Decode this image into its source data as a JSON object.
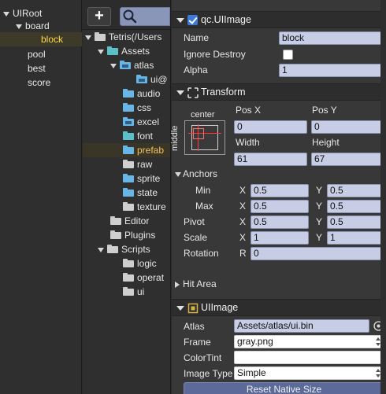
{
  "hierarchy": {
    "root": "UIRoot",
    "board": "board",
    "block": "block",
    "pool": "pool",
    "best": "best",
    "score": "score"
  },
  "project": {
    "add_label": "+",
    "root": "Tetris(/Users",
    "assets": "Assets",
    "atlas": "atlas",
    "ui": "ui@",
    "audio": "audio",
    "css": "css",
    "excel": "excel",
    "font": "font",
    "prefab": "prefab",
    "raw": "raw",
    "sprite": "sprite",
    "state": "state",
    "texture": "texture",
    "editor": "Editor",
    "plugins": "Plugins",
    "scripts": "Scripts",
    "logic": "logic",
    "operat": "operat",
    "ui_scripts": "ui"
  },
  "inspector": {
    "component_title": "qc.UIImage",
    "name_label": "Name",
    "name_value": "block",
    "ignore_destroy_label": "Ignore Destroy",
    "alpha_label": "Alpha",
    "alpha_value": "1",
    "transform_title": "Transform",
    "center_label": "center",
    "middle_label": "middle",
    "posx_label": "Pos X",
    "posy_label": "Pos Y",
    "posx_value": "0",
    "posy_value": "0",
    "width_label": "Width",
    "height_label": "Height",
    "width_value": "61",
    "height_value": "67",
    "anchors_label": "Anchors",
    "min_label": "Min",
    "max_label": "Max",
    "pivot_label": "Pivot",
    "scale_label": "Scale",
    "rotation_label": "Rotation",
    "x": "X",
    "y": "Y",
    "r": "R",
    "min_x": "0.5",
    "min_y": "0.5",
    "max_x": "0.5",
    "max_y": "0.5",
    "pivot_x": "0.5",
    "pivot_y": "0.5",
    "scale_x": "1",
    "scale_y": "1",
    "rotation_value": "0",
    "hit_area_label": "Hit Area",
    "uiimage_title": "UIImage",
    "atlas_label": "Atlas",
    "atlas_value": "Assets/atlas/ui.bin",
    "frame_label": "Frame",
    "frame_value": "gray.png",
    "colortint_label": "ColorTint",
    "image_type_label": "Image Type",
    "image_type_value": "Simple",
    "reset_label": "Reset Native Size"
  },
  "colors": {
    "accent_selected": "#ffd84a",
    "field_bg": "#c7cde4",
    "checkbox_blue": "#3f79d8"
  }
}
